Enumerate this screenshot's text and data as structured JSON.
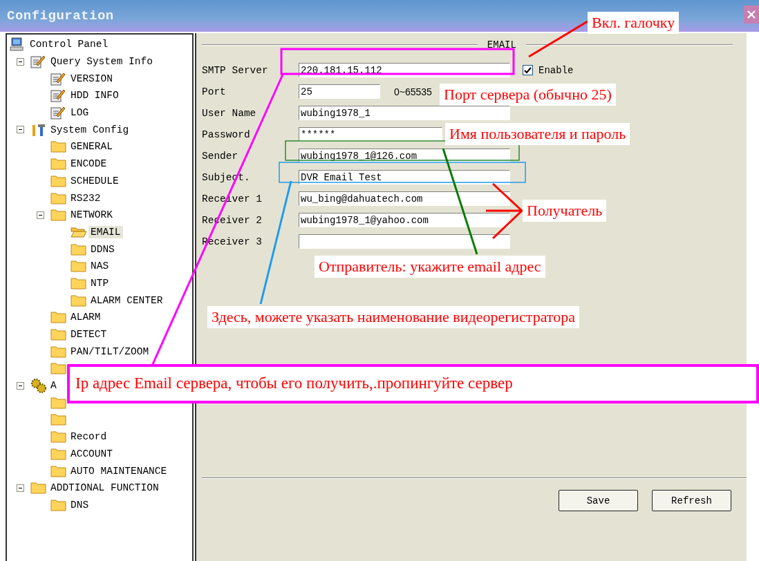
{
  "window": {
    "title": "Configuration"
  },
  "tree": [
    {
      "label": "Control Panel",
      "kind": "computer",
      "selected": false,
      "children": [
        {
          "label": "Query System Info",
          "kind": "notepad",
          "selected": false,
          "expanded": true,
          "children": [
            {
              "label": "VERSION",
              "kind": "notepad",
              "selected": false
            },
            {
              "label": "HDD INFO",
              "kind": "notepad",
              "selected": false
            },
            {
              "label": "LOG",
              "kind": "notepad",
              "selected": false
            }
          ]
        },
        {
          "label": "System Config",
          "kind": "tools",
          "selected": false,
          "expanded": true,
          "children": [
            {
              "label": "GENERAL",
              "kind": "folder",
              "selected": false
            },
            {
              "label": "ENCODE",
              "kind": "folder",
              "selected": false
            },
            {
              "label": "SCHEDULE",
              "kind": "folder",
              "selected": false
            },
            {
              "label": "RS232",
              "kind": "folder",
              "selected": false
            },
            {
              "label": "NETWORK",
              "kind": "folder",
              "selected": false,
              "expanded": true,
              "children": [
                {
                  "label": "EMAIL",
                  "kind": "folder",
                  "selected": true
                },
                {
                  "label": "DDNS",
                  "kind": "folder",
                  "selected": false
                },
                {
                  "label": "NAS",
                  "kind": "folder",
                  "selected": false
                },
                {
                  "label": "NTP",
                  "kind": "folder",
                  "selected": false
                },
                {
                  "label": "ALARM CENTER",
                  "kind": "folder",
                  "selected": false
                }
              ]
            },
            {
              "label": "ALARM",
              "kind": "folder",
              "selected": false
            },
            {
              "label": "DETECT",
              "kind": "folder",
              "selected": false
            },
            {
              "label": "PAN/TILT/ZOOM",
              "kind": "folder",
              "selected": false
            },
            {
              "kind": "folder",
              "selected": false
            }
          ]
        },
        {
          "label": "A",
          "kind": "gear",
          "selected": false,
          "expanded": true,
          "children": [
            {
              "kind": "folder",
              "selected": false
            },
            {
              "kind": "folder",
              "selected": false
            },
            {
              "label": "Record",
              "kind": "folder",
              "selected": false
            },
            {
              "label": "ACCOUNT",
              "kind": "folder",
              "selected": false
            },
            {
              "label": "AUTO MAINTENANCE",
              "kind": "folder",
              "selected": false
            }
          ]
        },
        {
          "label": "ADDTIONAL FUNCTION",
          "kind": "folder",
          "selected": false,
          "expanded": true,
          "children": [
            {
              "label": "DNS",
              "kind": "folder",
              "selected": false
            }
          ]
        }
      ]
    }
  ],
  "section": {
    "title": "EMAIL"
  },
  "fields": [
    {
      "label": "SMTP Server",
      "value": "220.181.15.112",
      "kind": "server"
    },
    {
      "label": "Port",
      "value": "25",
      "kind": "port",
      "hint": "0~65535"
    },
    {
      "label": "User Name",
      "value": "wubing1978_1",
      "kind": "text"
    },
    {
      "label": "Password",
      "value": "******",
      "kind": "password"
    },
    {
      "label": "Sender",
      "value": "wubing1978_1@126.com",
      "kind": "text"
    },
    {
      "label": "Subject.",
      "value": "DVR Email Test",
      "kind": "text"
    },
    {
      "label": "Receiver 1",
      "value": "wu_bing@dahuatech.com",
      "kind": "text"
    },
    {
      "label": "Receiver 2",
      "value": "wubing1978_1@yahoo.com",
      "kind": "text"
    },
    {
      "label": "Receiver 3",
      "kind": "text"
    }
  ],
  "enable": {
    "label": "Enable",
    "checked": true
  },
  "buttons": [
    "Save",
    "Refresh"
  ],
  "annotations": [
    {
      "text": "Вкл. галочку",
      "kind": "plain"
    },
    {
      "text": "Порт сервера (обычно 25)",
      "kind": "plain"
    },
    {
      "text": "Имя пользователя и пароль",
      "kind": "plain"
    },
    {
      "text": "Получатель",
      "kind": "plain"
    },
    {
      "text": "Отправитель: укажите email адрес",
      "kind": "plain"
    },
    {
      "text": "Здесь, можете указать наименование видеорегистратора",
      "kind": "plain"
    },
    {
      "text": "Ip адрес Email сервера, чтобы его получить,.пропингуйте сервер",
      "kind": "framed"
    }
  ]
}
